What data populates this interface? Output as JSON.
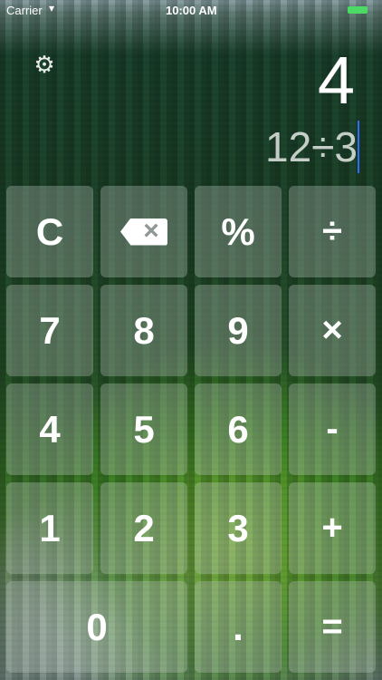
{
  "status_bar": {
    "carrier": "Carrier",
    "wifi_icon": "wifi-icon",
    "time": "10:00 AM",
    "battery_icon": "battery-icon",
    "battery_color": "#4cd964"
  },
  "display": {
    "result": "4",
    "expression": "12÷3"
  },
  "settings_icon": "gear-icon",
  "keypad": {
    "clear": "C",
    "backspace_icon": "backspace-icon",
    "backspace_glyph": "×",
    "percent": "%",
    "divide": "÷",
    "seven": "7",
    "eight": "8",
    "nine": "9",
    "multiply": "×",
    "four": "4",
    "five": "5",
    "six": "6",
    "minus": "-",
    "one": "1",
    "two": "2",
    "three": "3",
    "plus": "+",
    "zero": "0",
    "decimal": ".",
    "equals": "="
  }
}
